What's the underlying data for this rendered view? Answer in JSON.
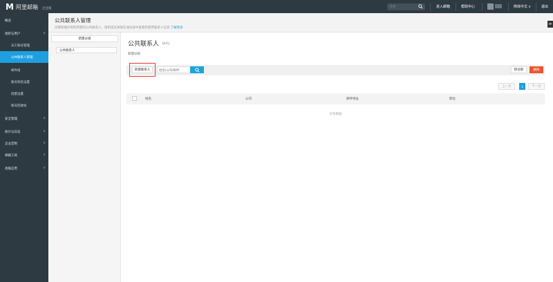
{
  "topbar": {
    "logo_mark": "M",
    "logo_text": "阿里邮箱",
    "logo_sub": "企业版",
    "search_placeholder": "搜索",
    "links": [
      "进入邮箱",
      "帮助中心",
      "简体中文",
      "退出"
    ],
    "language_chevron": "∨"
  },
  "sidebar": {
    "items": [
      {
        "label": "概览",
        "sub": false,
        "active": false,
        "chevron": ""
      },
      {
        "label": "组织与用户",
        "sub": false,
        "active": false,
        "chevron": "∧"
      },
      {
        "label": "员工账号管理",
        "sub": true,
        "active": false,
        "chevron": ""
      },
      {
        "label": "公共联系人管理",
        "sub": true,
        "active": true,
        "chevron": ""
      },
      {
        "label": "邮件组",
        "sub": true,
        "active": false,
        "chevron": ""
      },
      {
        "label": "账号别名设置",
        "sub": true,
        "active": false,
        "chevron": ""
      },
      {
        "label": "批量设置",
        "sub": true,
        "active": false,
        "chevron": ""
      },
      {
        "label": "账号回收站",
        "sub": true,
        "active": false,
        "chevron": ""
      },
      {
        "label": "安全管理",
        "sub": false,
        "active": false,
        "chevron": "∨"
      },
      {
        "label": "统计与日志",
        "sub": false,
        "active": false,
        "chevron": "∨"
      },
      {
        "label": "企业定制",
        "sub": false,
        "active": false,
        "chevron": "∨"
      },
      {
        "label": "邮箱工具",
        "sub": false,
        "active": false,
        "chevron": "∨"
      },
      {
        "label": "高级应用",
        "sub": false,
        "active": false,
        "chevron": "∨"
      }
    ]
  },
  "header": {
    "title": "公共联系人管理",
    "description": "创建和维护组织所需的公共联系人，组织成员将能在通讯录中查看和使用联系人信息",
    "learn_more": "了解更多",
    "collapse": "≫"
  },
  "groups": {
    "new_group_button": "新建分组",
    "items": [
      "公共联系人"
    ]
  },
  "main": {
    "title": "公共联系人",
    "count": "(0人)",
    "new_group_link": "新建分组",
    "new_contact_button": "新建联系人",
    "search_placeholder": "姓名/公司/邮件",
    "move_button": "移动到",
    "delete_button": "删除"
  },
  "pager": {
    "prev": "上一页",
    "current": "1",
    "next": "下一页"
  },
  "table": {
    "columns": [
      "姓名",
      "公司",
      "邮件地址",
      "职位"
    ],
    "empty_text": "没有数据"
  },
  "colors": {
    "sidebar_bg": "#2d3a42",
    "accent": "#1e9fe0",
    "delete": "#e9572b",
    "highlight_box": "#e33333"
  }
}
